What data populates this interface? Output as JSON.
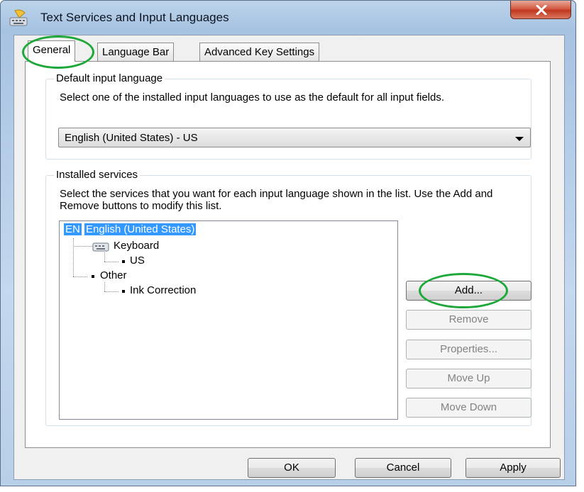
{
  "window": {
    "title": "Text Services and Input Languages",
    "icon": "keyboard-icon"
  },
  "tabs": [
    {
      "label": "General",
      "active": true
    },
    {
      "label": "Language Bar",
      "active": false
    },
    {
      "label": "Advanced Key Settings",
      "active": false
    }
  ],
  "default_language": {
    "legend": "Default input language",
    "description": "Select one of the installed input languages to use as the default for all input fields.",
    "selected": "English (United States) - US"
  },
  "installed_services": {
    "legend": "Installed services",
    "description": "Select the services that you want for each input language shown in the list. Use the Add and Remove buttons to modify this list.",
    "tree": {
      "badge": "EN",
      "language": "English (United States)",
      "keyboard": "Keyboard",
      "keyboard_layout": "US",
      "other": "Other",
      "other_item": "Ink Correction"
    },
    "buttons": {
      "add": "Add...",
      "remove": "Remove",
      "properties": "Properties...",
      "move_up": "Move Up",
      "move_down": "Move Down"
    }
  },
  "footer": {
    "ok": "OK",
    "cancel": "Cancel",
    "apply": "Apply"
  },
  "colors": {
    "highlight": "#1fa83a",
    "selection": "#3399ff",
    "close_button": "#c0381e"
  }
}
